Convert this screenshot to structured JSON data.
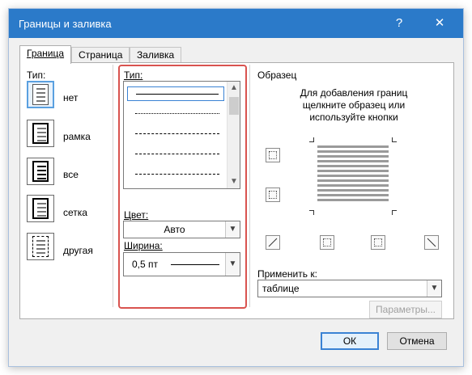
{
  "window": {
    "title": "Границы и заливка",
    "help_label": "?",
    "close_label": "✕"
  },
  "tabs": [
    {
      "label": "Граница",
      "active": true
    },
    {
      "label": "Страница",
      "active": false
    },
    {
      "label": "Заливка",
      "active": false
    }
  ],
  "setting": {
    "label": "Тип:",
    "items": [
      {
        "label": "нет",
        "icon": "none-border-icon",
        "selected": true
      },
      {
        "label": "рамка",
        "icon": "box-border-icon",
        "selected": false
      },
      {
        "label": "все",
        "icon": "all-borders-icon",
        "selected": false
      },
      {
        "label": "сетка",
        "icon": "grid-border-icon",
        "selected": false
      },
      {
        "label": "другая",
        "icon": "custom-border-icon",
        "selected": false
      }
    ]
  },
  "style": {
    "label": "Тип:",
    "options": [
      "solid",
      "dotted",
      "dashed-small",
      "dashed",
      "dash-dot"
    ],
    "selected_index": 0
  },
  "color": {
    "label": "Цвет:",
    "value": "Авто"
  },
  "width": {
    "label": "Ширина:",
    "value": "0,5 пт"
  },
  "preview": {
    "label": "Образец",
    "hint": "Для добавления границ щелкните образец или используйте кнопки"
  },
  "apply_to": {
    "label": "Применить к:",
    "value": "таблице"
  },
  "buttons": {
    "options": "Параметры...",
    "ok": "ОК",
    "cancel": "Отмена"
  },
  "colors": {
    "titlebar": "#2b7ac9",
    "highlight_box": "#d9534f",
    "selection": "#3a82d4"
  }
}
